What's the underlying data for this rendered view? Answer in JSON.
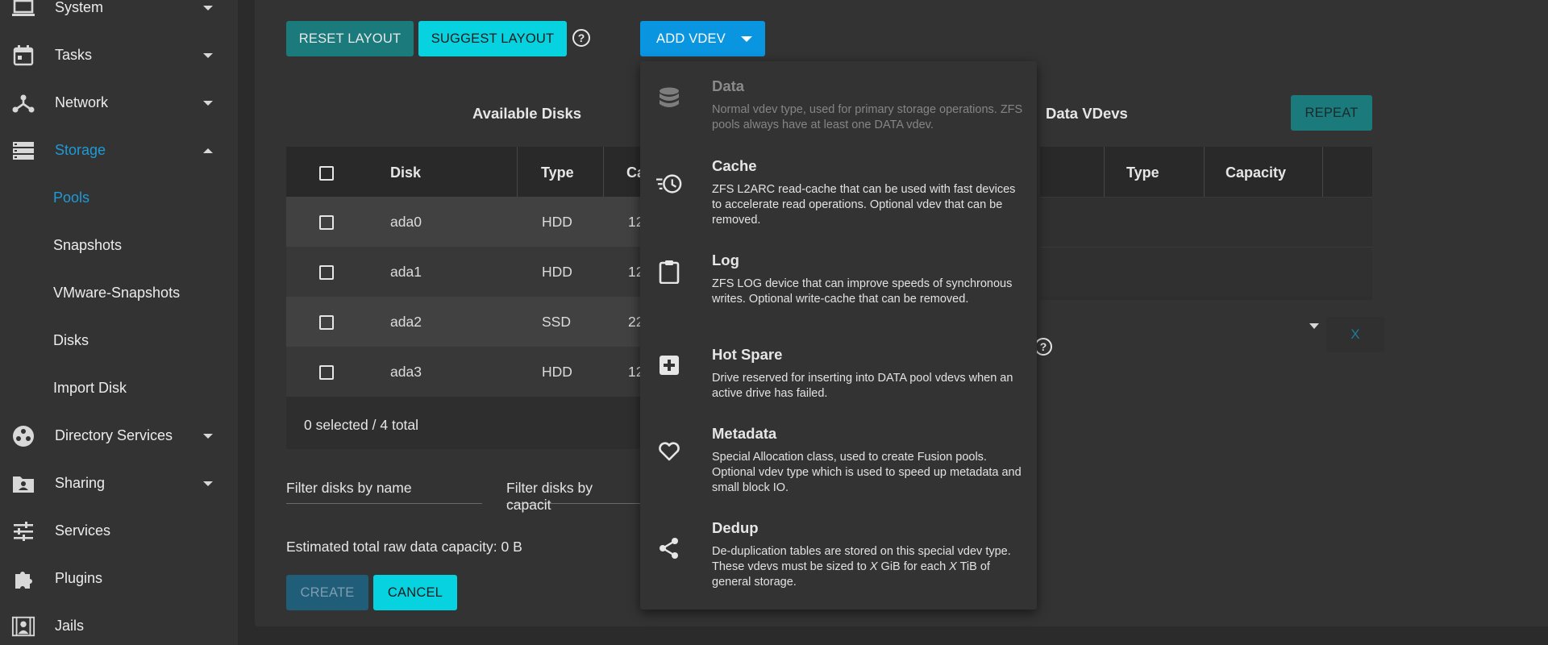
{
  "sidebar": {
    "items": [
      {
        "label": "System",
        "icon": "laptop-icon"
      },
      {
        "label": "Tasks",
        "icon": "calendar-icon"
      },
      {
        "label": "Network",
        "icon": "network-icon"
      },
      {
        "label": "Storage",
        "icon": "storage-icon"
      },
      {
        "label": "Directory Services",
        "icon": "directory-services-icon"
      },
      {
        "label": "Sharing",
        "icon": "folder-share-icon"
      },
      {
        "label": "Services",
        "icon": "tune-icon"
      },
      {
        "label": "Plugins",
        "icon": "puzzle-icon"
      },
      {
        "label": "Jails",
        "icon": "jail-icon"
      }
    ],
    "storage_subitems": [
      "Pools",
      "Snapshots",
      "VMware-Snapshots",
      "Disks",
      "Import Disk"
    ]
  },
  "toolbar": {
    "reset_layout": "RESET LAYOUT",
    "suggest_layout": "SUGGEST LAYOUT",
    "add_vdev": "ADD VDEV"
  },
  "available_disks": {
    "title": "Available Disks",
    "columns": [
      "Disk",
      "Type",
      "Ca"
    ],
    "rows": [
      {
        "disk": "ada0",
        "type": "HDD",
        "capacity": "12"
      },
      {
        "disk": "ada1",
        "type": "HDD",
        "capacity": "12"
      },
      {
        "disk": "ada2",
        "type": "SSD",
        "capacity": "22"
      },
      {
        "disk": "ada3",
        "type": "HDD",
        "capacity": "12"
      }
    ],
    "footer": "0 selected / 4 total"
  },
  "data_vdevs": {
    "title": "Data VDevs",
    "repeat_label": "REPEAT",
    "columns": [
      "Type",
      "Capacity"
    ],
    "remove_label": "X"
  },
  "filters": {
    "by_name": "Filter disks by name",
    "by_capacity": "Filter disks by capacit"
  },
  "estimate": "Estimated total raw data capacity: 0 B",
  "actions": {
    "create": "CREATE",
    "cancel": "CANCEL"
  },
  "add_vdev_menu": [
    {
      "title": "Data",
      "desc": "Normal vdev type, used for primary storage operations. ZFS pools always have at least one DATA vdev.",
      "icon": "database-icon",
      "disabled": true
    },
    {
      "title": "Cache",
      "desc": "ZFS L2ARC read-cache that can be used with fast devices to accelerate read operations. Optional vdev that can be removed.",
      "icon": "cache-clock-icon",
      "disabled": false
    },
    {
      "title": "Log",
      "desc": "ZFS LOG device that can improve speeds of synchronous writes. Optional write-cache that can be removed.",
      "icon": "clipboard-icon",
      "disabled": false
    },
    {
      "title": "Hot Spare",
      "desc": "Drive reserved for inserting into DATA pool vdevs when an active drive has failed.",
      "icon": "plus-box-icon",
      "disabled": false
    },
    {
      "title": "Metadata",
      "desc": "Special Allocation class, used to create Fusion pools. Optional vdev type which is used to speed up metadata and small block IO.",
      "icon": "heart-icon",
      "disabled": false
    },
    {
      "title": "Dedup",
      "desc_parts": [
        "De-duplication tables are stored on this special vdev type. These vdevs must be sized to ",
        "X",
        " GiB for each ",
        "X",
        " TiB of general storage."
      ],
      "icon": "share-icon",
      "disabled": false
    }
  ],
  "colors": {
    "accent_blue": "#0a95e0",
    "accent_cyan": "#07d3e0",
    "teal": "#1a7a7c",
    "active_nav": "#1e9ad6"
  }
}
